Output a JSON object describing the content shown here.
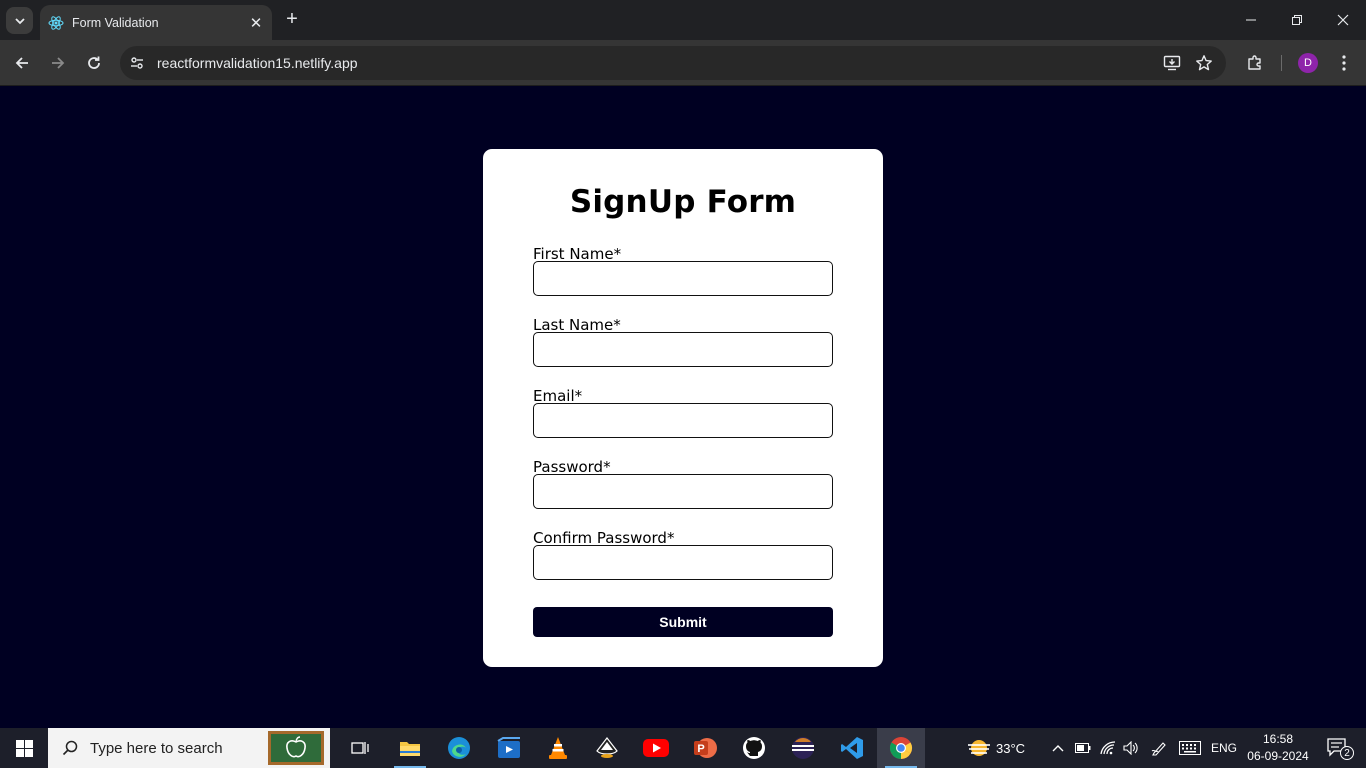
{
  "browser": {
    "tab_title": "Form Validation",
    "url": "reactformvalidation15.netlify.app",
    "profile_initial": "D",
    "profile_color": "#8e24aa"
  },
  "form": {
    "title": "SignUp Form",
    "fields": [
      {
        "label": "First Name*",
        "value": ""
      },
      {
        "label": "Last Name*",
        "value": ""
      },
      {
        "label": "Email*",
        "value": ""
      },
      {
        "label": "Password*",
        "value": ""
      },
      {
        "label": "Confirm Password*",
        "value": ""
      }
    ],
    "submit_label": "Submit",
    "page_background": "#000022",
    "card_background": "#ffffff"
  },
  "taskbar": {
    "search_placeholder": "Type here to search",
    "weather": "33°C",
    "language": "ENG",
    "time": "16:58",
    "date": "06-09-2024",
    "notification_count": "2",
    "apps": [
      "task-view",
      "file-explorer",
      "edge",
      "media-player",
      "vlc",
      "inkscape",
      "youtube",
      "powerpoint",
      "github",
      "eclipse",
      "vscode",
      "chrome"
    ]
  }
}
